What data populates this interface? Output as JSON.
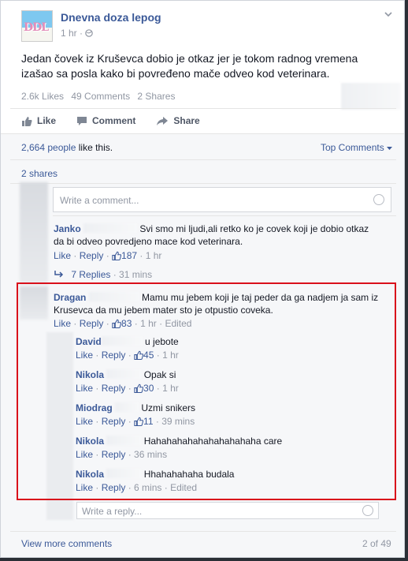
{
  "post": {
    "page_name": "Dnevna doza lepog",
    "logo_text": "DDL",
    "time": "1 hr ·",
    "text": "Jedan čovek iz Kruševca dobio je otkaz jer je tokom radnog vremena izašao sa posla kako bi povređeno mače odveo kod veterinara.",
    "likes": "2.6k Likes",
    "comments": "49 Comments",
    "shares": "2 Shares"
  },
  "actions": {
    "like": "Like",
    "comment": "Comment",
    "share": "Share"
  },
  "summary": {
    "people_count": "2,664 people",
    "like_this": " like this.",
    "top_comments": "Top Comments",
    "two_shares": "2 shares"
  },
  "write_comment_placeholder": "Write a comment...",
  "comments": [
    {
      "author": "Janko",
      "text_line1": "Svi smo mi ljudi,ali retko ko je covek koji je dobio otkaz",
      "text_line2": "da bi odveo povredjeno mace kod veterinara.",
      "like": "Like",
      "reply": "Reply",
      "likes": "187",
      "time": "1 hr",
      "replies": "7 Replies",
      "replies_time": "· 31 mins"
    },
    {
      "author": "Dragan",
      "text_line1": "Mamu mu jebem koji je taj peder da ga nadjem ja sam iz",
      "text_line2": "Krusevca da mu jebem mater sto je otpustio coveka.",
      "like": "Like",
      "reply": "Reply",
      "likes": "83",
      "time": "1 hr",
      "edited": "Edited"
    }
  ],
  "replies": [
    {
      "author": "David",
      "text": "u jebote",
      "like": "Like",
      "reply": "Reply",
      "likes": "45",
      "time": "1 hr"
    },
    {
      "author": "Nikola",
      "text": "Opak si",
      "like": "Like",
      "reply": "Reply",
      "likes": "30",
      "time": "1 hr"
    },
    {
      "author": "Miodrag",
      "text": "Uzmi snikers",
      "like": "Like",
      "reply": "Reply",
      "likes": "11",
      "time": "39 mins"
    },
    {
      "author": "Nikola",
      "text": "Hahahahahahahahahahaha care",
      "like": "Like",
      "reply": "Reply",
      "time": "36 mins"
    },
    {
      "author": "Nikola",
      "text": "Hhahahahaha budala",
      "like": "Like",
      "reply": "Reply",
      "time": "6 mins",
      "edited": "Edited"
    }
  ],
  "write_reply_placeholder": "Write a reply...",
  "footer": {
    "view_more": "View more comments",
    "pagination": "2 of 49"
  },
  "colors": {
    "link": "#3b5998",
    "highlight_border": "#d9101b",
    "meta": "#9197a3"
  }
}
